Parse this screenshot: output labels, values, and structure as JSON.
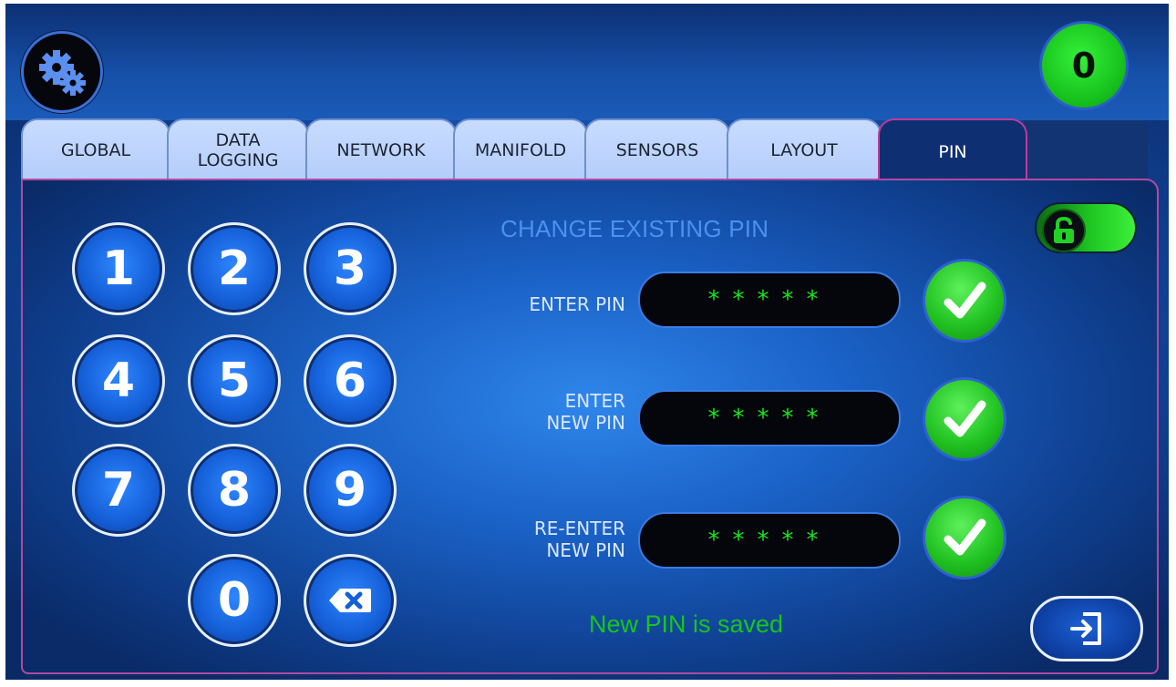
{
  "header": {
    "settings_icon": "gears-icon",
    "counter_value": "0"
  },
  "tabs": [
    {
      "label": "GLOBAL"
    },
    {
      "label": "DATA\nLOGGING"
    },
    {
      "label": "NETWORK"
    },
    {
      "label": "MANIFOLD"
    },
    {
      "label": "SENSORS"
    },
    {
      "label": "LAYOUT"
    },
    {
      "label": "PIN",
      "active": true
    }
  ],
  "keypad": {
    "keys": [
      "1",
      "2",
      "3",
      "4",
      "5",
      "6",
      "7",
      "8",
      "9",
      "0"
    ],
    "backspace_icon": "backspace-icon"
  },
  "pin_form": {
    "title": "CHANGE EXISTING PIN",
    "rows": [
      {
        "label_line1": "ENTER PIN",
        "label_line2": "",
        "value": "*****"
      },
      {
        "label_line1": "ENTER",
        "label_line2": "NEW PIN",
        "value": "*****"
      },
      {
        "label_line1": "RE-ENTER",
        "label_line2": "NEW PIN",
        "value": "*****"
      }
    ],
    "status": "New PIN is saved"
  },
  "lock_toggle": {
    "state": "unlocked",
    "icon": "unlocked-padlock-icon"
  },
  "exit": {
    "icon": "exit-icon"
  },
  "colors": {
    "accent_blue": "#2a6fe0",
    "success_green": "#1ec521",
    "pin_text_green": "#1be51f",
    "title_blue": "#4a92f0",
    "tab_bg": "#bfd6ff",
    "active_tab_border": "#c03a9a"
  }
}
